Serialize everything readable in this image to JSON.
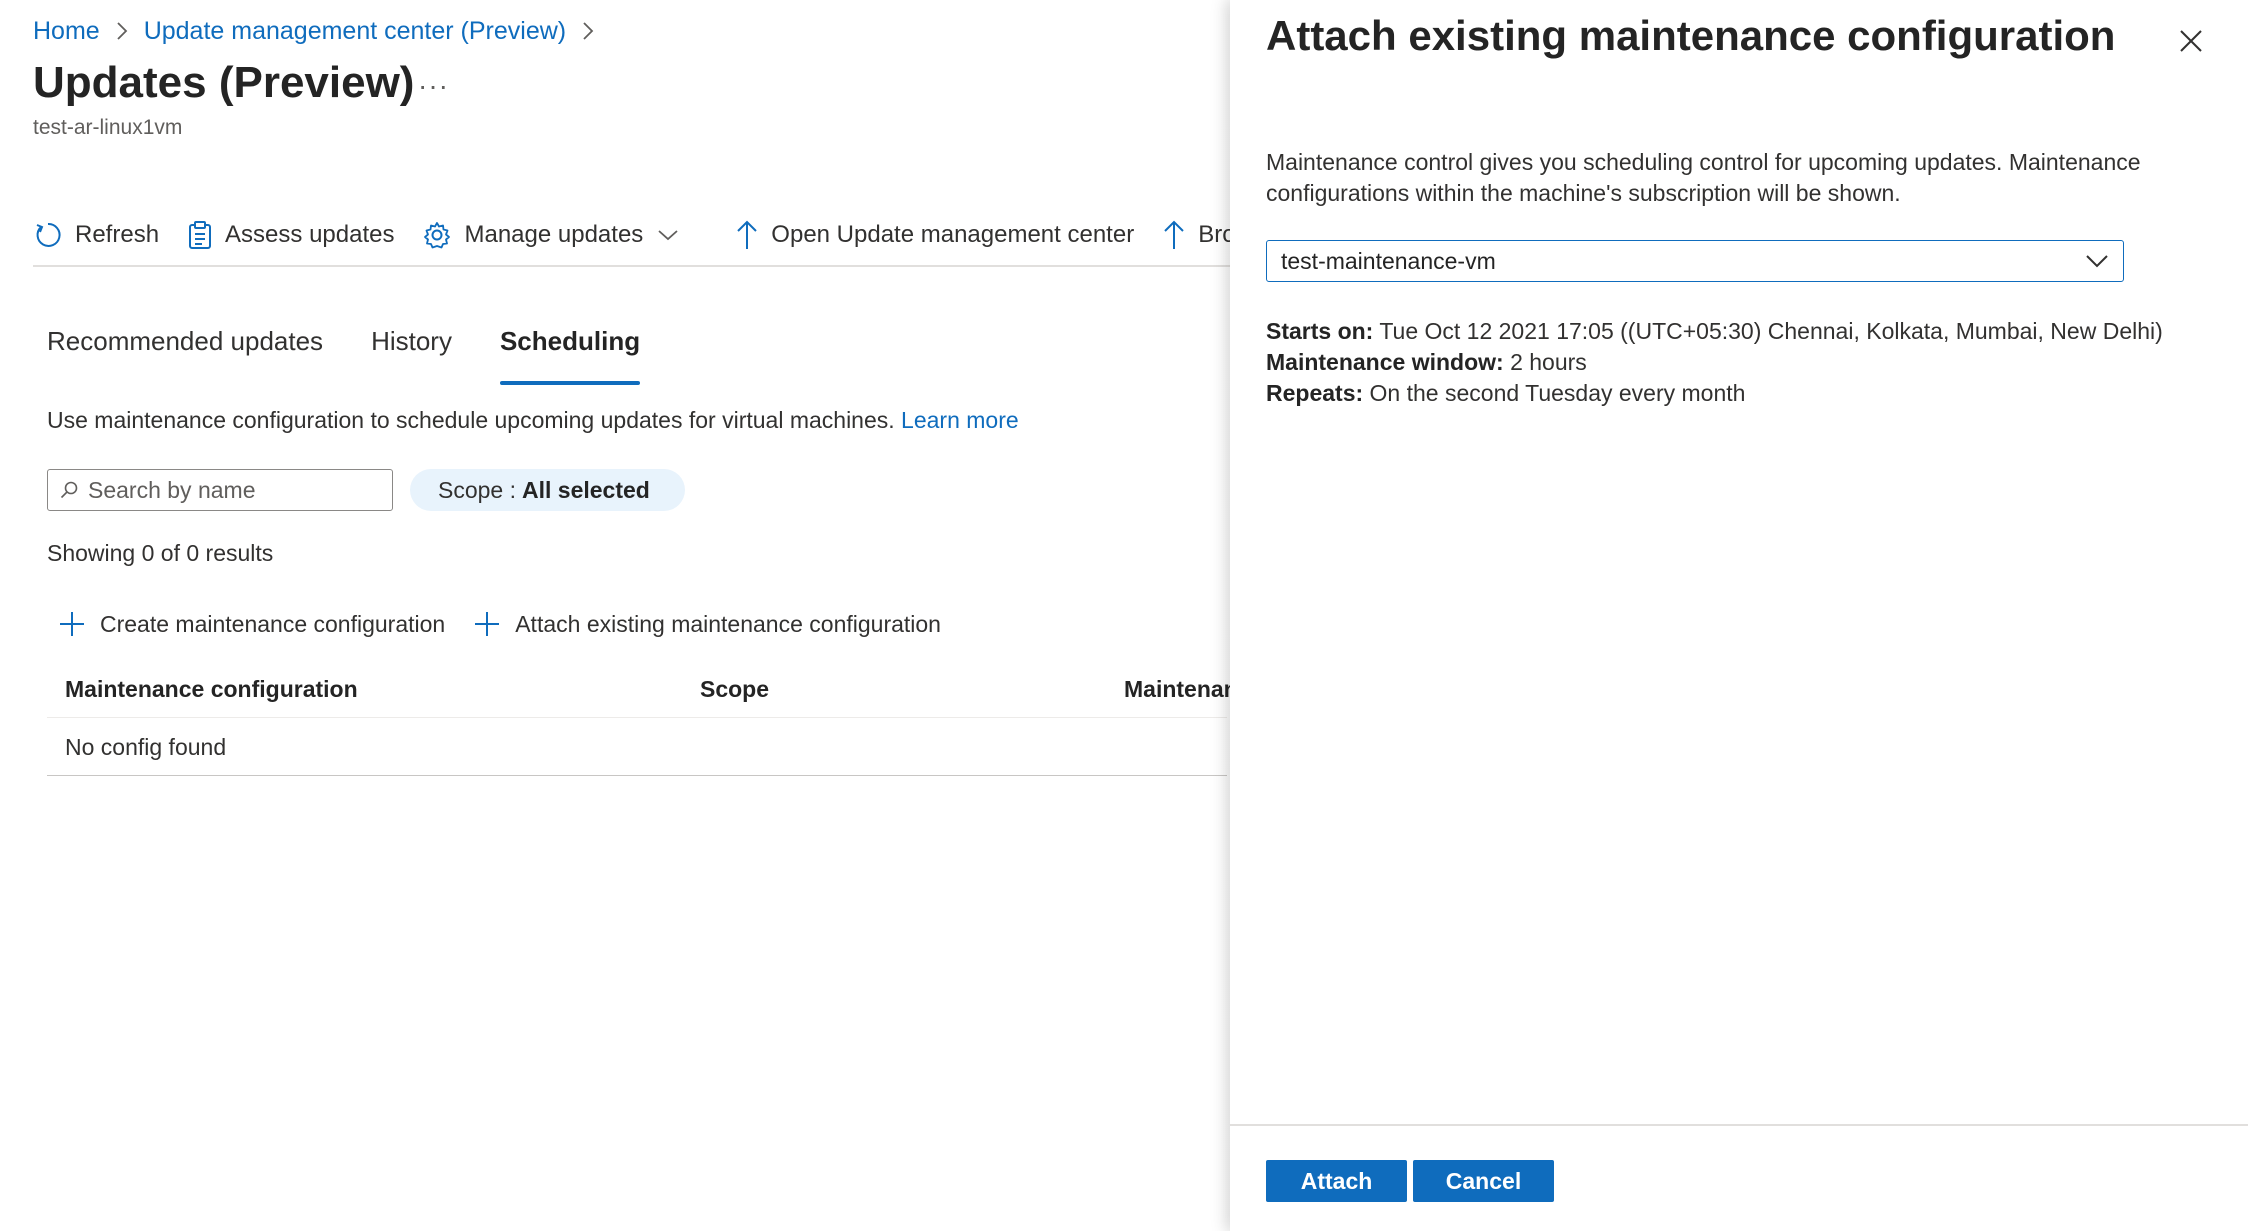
{
  "breadcrumb": {
    "items": [
      "Home",
      "Update management center (Preview)"
    ]
  },
  "page": {
    "title": "Updates (Preview)",
    "more": "···",
    "subtitle": "test-ar-linux1vm"
  },
  "toolbar": {
    "refresh": "Refresh",
    "assess": "Assess updates",
    "manage": "Manage updates",
    "open_center": "Open Update management center",
    "browse": "Brows"
  },
  "tabs": {
    "recommended": "Recommended updates",
    "history": "History",
    "scheduling": "Scheduling",
    "active": "Scheduling"
  },
  "scheduling": {
    "description": "Use maintenance configuration to schedule upcoming updates for virtual machines.",
    "learn_more": "Learn more",
    "search_placeholder": "Search by name",
    "scope_label": "Scope :",
    "scope_value": "All selected",
    "results": "Showing 0 of 0 results",
    "create_action": "Create maintenance configuration",
    "attach_action": "Attach existing maintenance configuration"
  },
  "grid": {
    "columns": [
      "Maintenance configuration",
      "Scope",
      "Maintenan"
    ],
    "empty": "No config found"
  },
  "panel": {
    "title": "Attach existing maintenance configuration",
    "description": "Maintenance control gives you scheduling control for upcoming updates. Maintenance configurations within the machine's subscription will be shown.",
    "selected_config": "test-maintenance-vm",
    "starts_on_label": "Starts on:",
    "starts_on_value": "Tue Oct 12 2021 17:05 ((UTC+05:30) Chennai, Kolkata, Mumbai, New Delhi)",
    "window_label": "Maintenance window:",
    "window_value": "2 hours",
    "repeats_label": "Repeats:",
    "repeats_value": "On the second Tuesday every month",
    "attach_button": "Attach",
    "cancel_button": "Cancel"
  },
  "colors": {
    "accent": "#0f6cbd",
    "scope_pill_bg": "#e8f3fc",
    "text": "#323130"
  },
  "icons": [
    "chevron-right-icon",
    "refresh-icon",
    "clipboard-icon",
    "gear-icon",
    "chevron-down-icon",
    "arrow-up-icon",
    "search-icon",
    "plus-icon",
    "close-icon"
  ]
}
